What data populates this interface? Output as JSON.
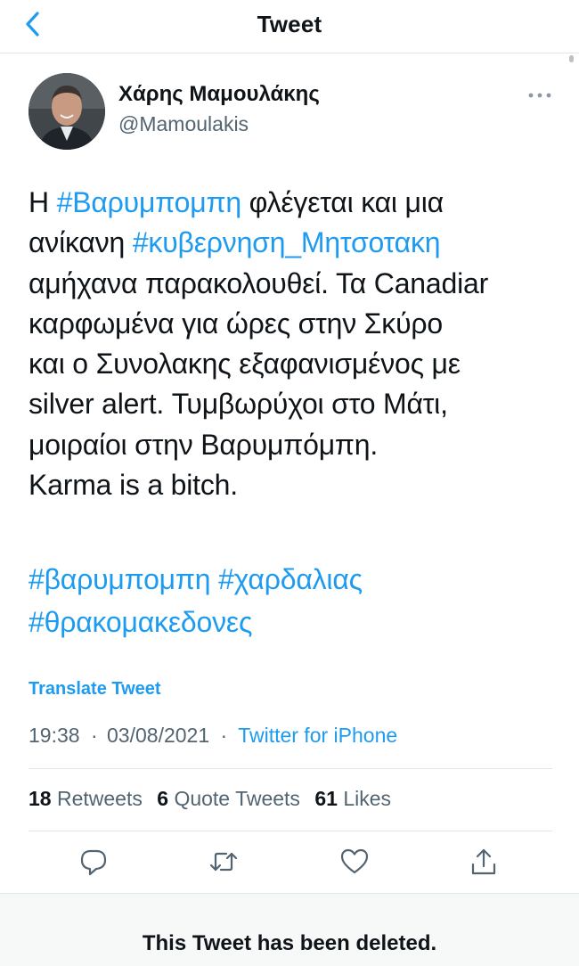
{
  "header": {
    "title": "Tweet",
    "back_icon": "chevron-left-icon"
  },
  "author": {
    "display_name": "Χάρης Μαμουλάκης",
    "handle": "@Mamoulakis"
  },
  "tweet": {
    "lines": [
      [
        {
          "text": "Η ",
          "tag": false
        },
        {
          "text": "#Βαρυμπομπη",
          "tag": true
        },
        {
          "text": " φλέγεται και μια",
          "tag": false
        }
      ],
      [
        {
          "text": "ανίκανη ",
          "tag": false
        },
        {
          "text": "#κυβερνηση_Μητσοτακη",
          "tag": true
        }
      ],
      [
        {
          "text": "αμήχανα παρακολουθεί. Τα Canadiar",
          "tag": false
        }
      ],
      [
        {
          "text": "καρφωμένα για ώρες στην Σκύρο",
          "tag": false
        }
      ],
      [
        {
          "text": "και ο Συνολακης εξαφανισμένος με",
          "tag": false
        }
      ],
      [
        {
          "text": "silver alert. Τυμβωρύχοι στο Μάτι,",
          "tag": false
        }
      ],
      [
        {
          "text": "μοιραίοι στην Βαρυμπόμπη.",
          "tag": false
        }
      ],
      [
        {
          "text": "Karma is a bitch.",
          "tag": false
        }
      ]
    ],
    "hashtag_lines": [
      "#βαρυμπομπη #χαρδαλιας",
      "#θρακομακεδονες"
    ],
    "translate_label": "Translate Tweet",
    "time": "19:38",
    "date": "03/08/2021",
    "separator": "·",
    "source": "Twitter for iPhone"
  },
  "stats": {
    "retweets_count": "18",
    "retweets_label": "Retweets",
    "quotes_count": "6",
    "quotes_label": "Quote Tweets",
    "likes_count": "61",
    "likes_label": "Likes"
  },
  "actions": [
    "reply-icon",
    "retweet-icon",
    "like-icon",
    "share-icon"
  ],
  "deleted_notice": "This Tweet has been deleted.",
  "colors": {
    "accent": "#1d9bf0",
    "text": "#0f1419",
    "muted": "#536471",
    "border": "#e1e6ea"
  }
}
